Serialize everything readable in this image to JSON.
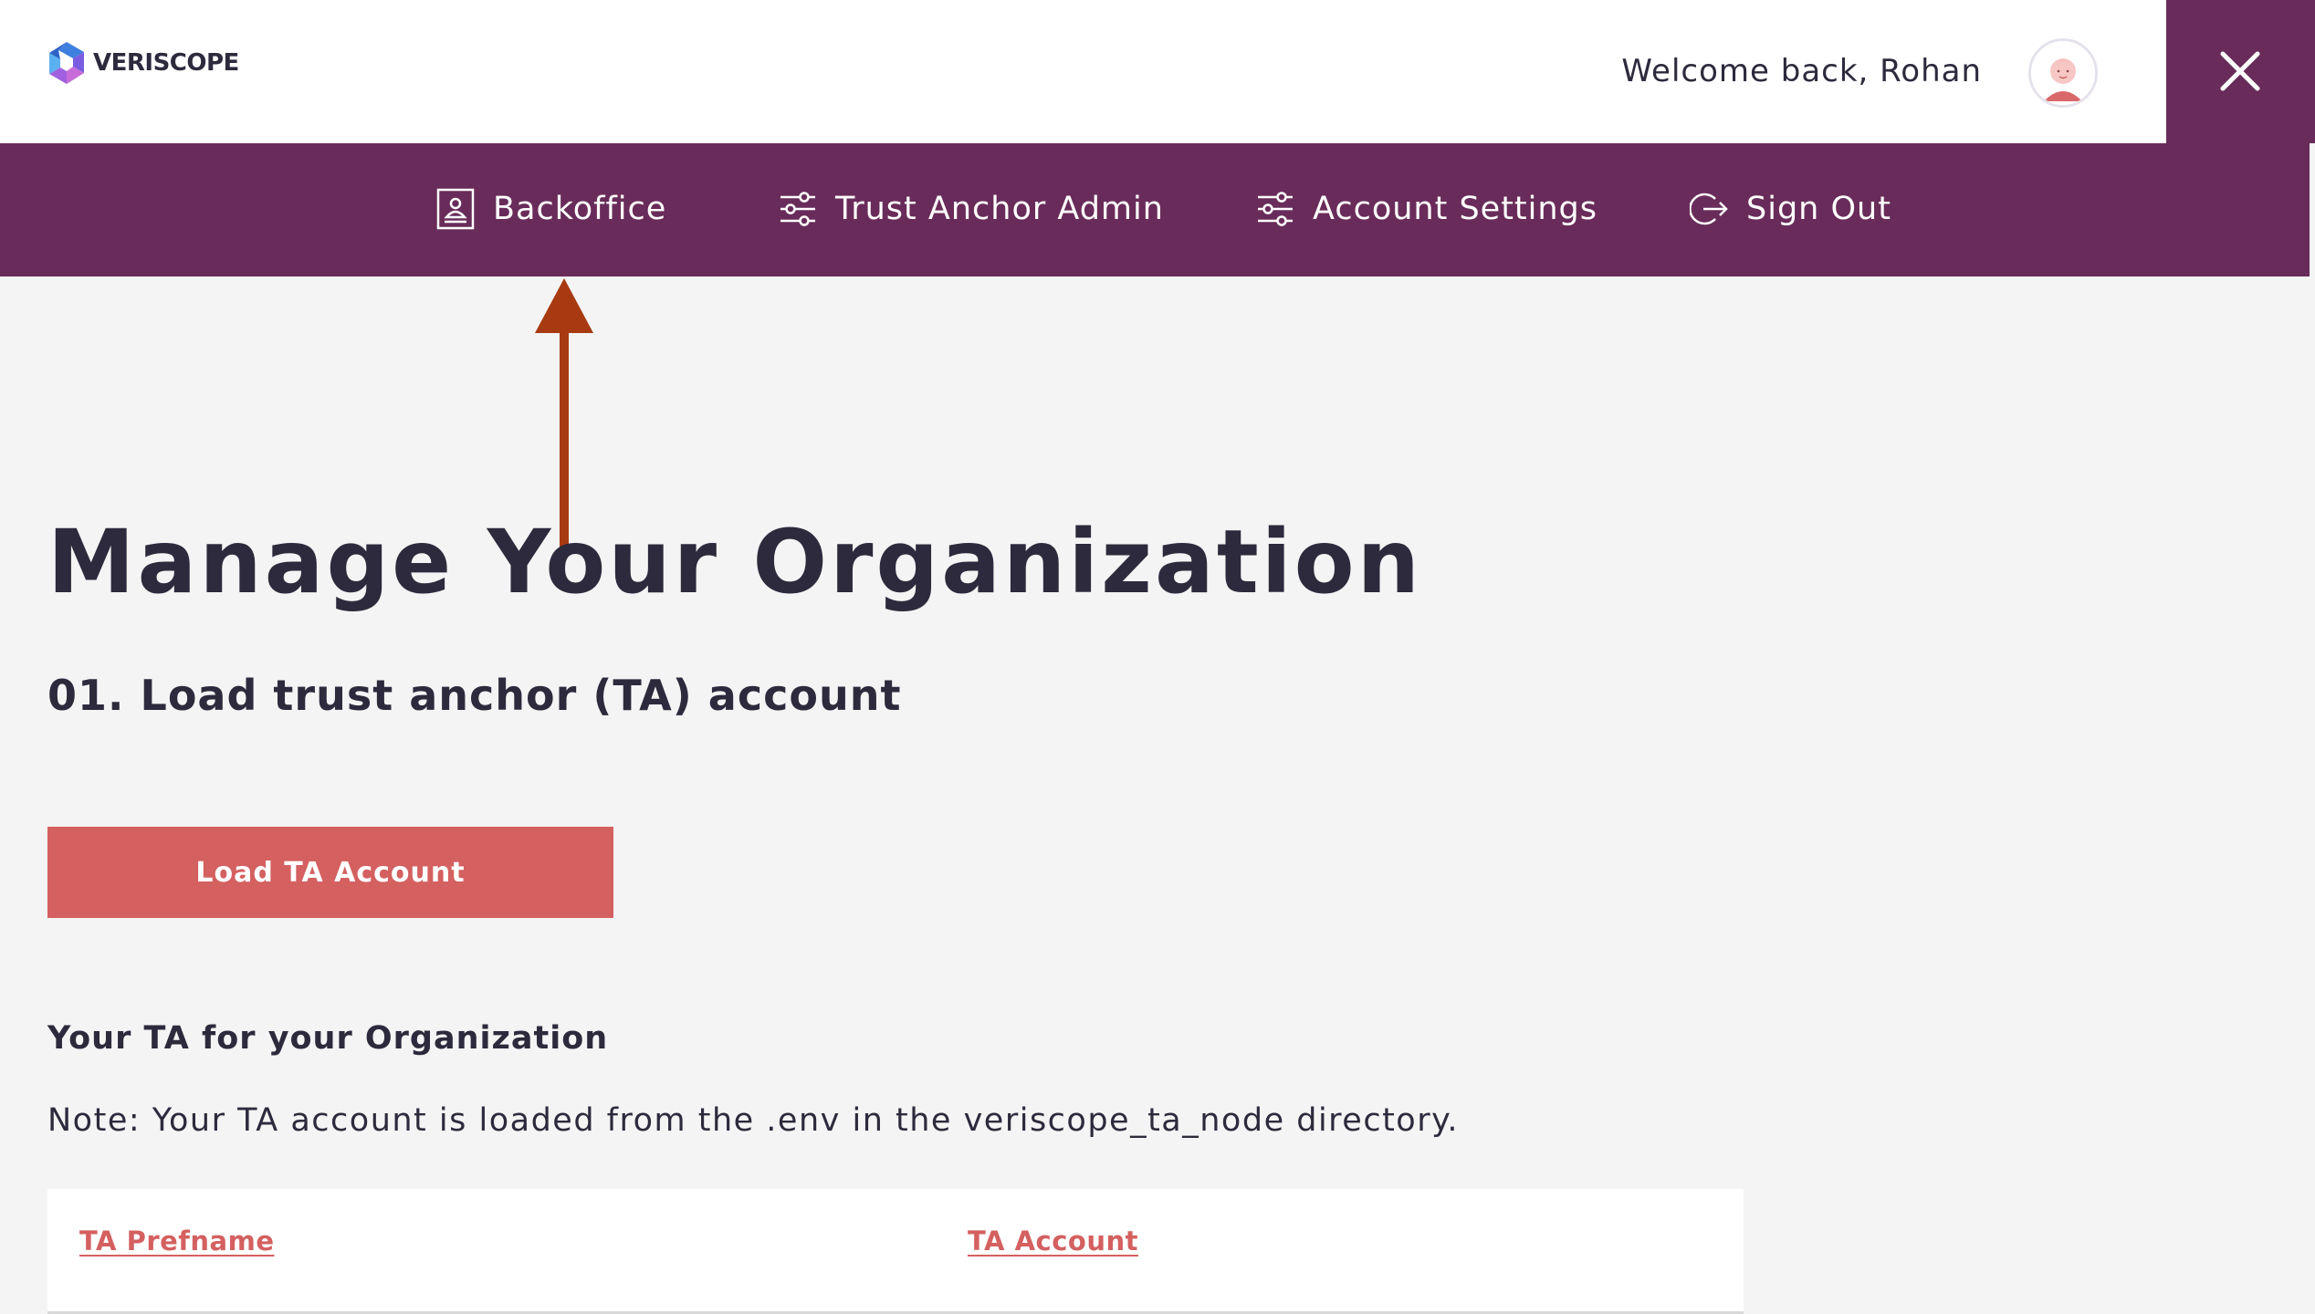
{
  "header": {
    "brand": "VERISCOPE",
    "welcome_text": "Welcome back, Rohan",
    "avatar_icon": "user-avatar",
    "close_icon": "close-icon"
  },
  "nav": {
    "items": [
      {
        "label": "Backoffice",
        "icon": "id-card-icon"
      },
      {
        "label": "Trust Anchor Admin",
        "icon": "sliders-icon"
      },
      {
        "label": "Account Settings",
        "icon": "sliders-icon"
      },
      {
        "label": "Sign Out",
        "icon": "sign-out-icon"
      }
    ]
  },
  "main": {
    "title": "Manage Your Organization",
    "section_title": "01. Load trust anchor (TA) account",
    "load_button_label": "Load TA Account",
    "subheading": "Your TA for your Organization",
    "note": "Note: Your TA account is loaded from the .env in the veriscope_ta_node directory.",
    "table": {
      "columns": [
        "TA Prefname",
        "TA Account"
      ]
    }
  },
  "colors": {
    "brand_purple": "#692c5a",
    "accent_red": "#d46060",
    "annotation_arrow": "#a83a12",
    "text_dark": "#2e2a3d",
    "page_background": "#f4f4f4"
  }
}
